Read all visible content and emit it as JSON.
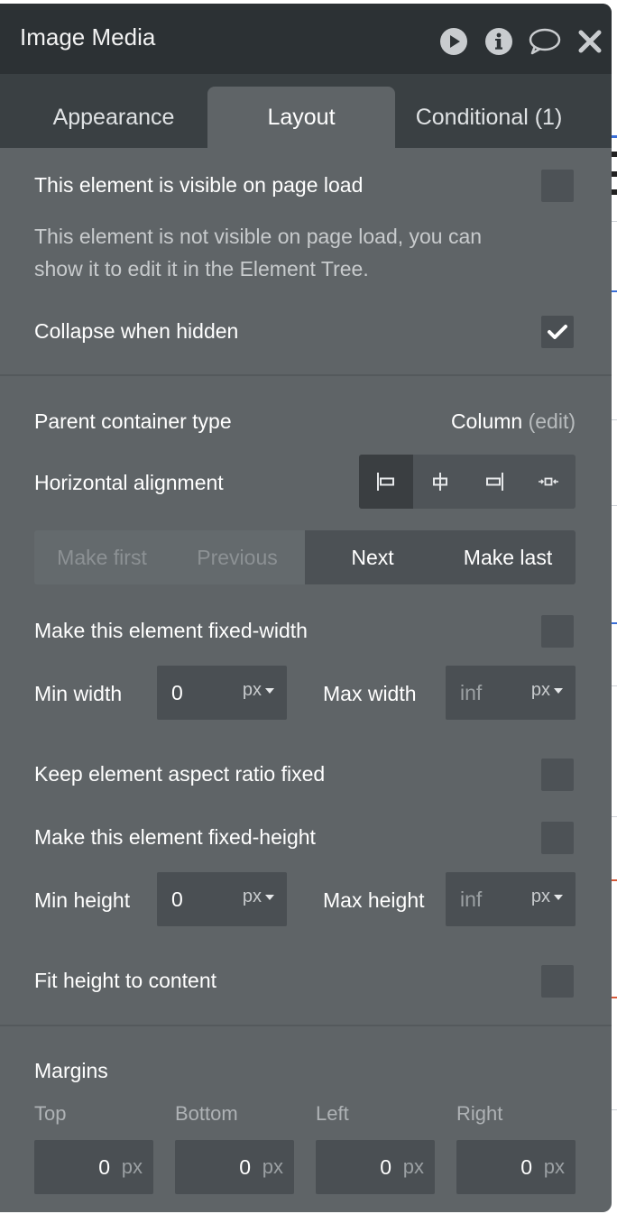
{
  "panel": {
    "title": "Image Media",
    "tabs": [
      {
        "label": "Appearance"
      },
      {
        "label": "Layout"
      },
      {
        "label": "Conditional (1)"
      }
    ]
  },
  "visibility": {
    "visible_label": "This element is visible on page load",
    "visible_checked": false,
    "hint_line1": "This element is not visible on page load, you can",
    "hint_line2": "show it to edit it in the Element Tree.",
    "collapse_label": "Collapse when hidden",
    "collapse_checked": true
  },
  "container": {
    "parent_type_label": "Parent container type",
    "parent_type_value": "Column",
    "edit_link": "(edit)",
    "halign_label": "Horizontal alignment",
    "halign_options": [
      "align-left-icon",
      "align-center-icon",
      "align-right-icon",
      "align-stretch-icon"
    ],
    "halign_selected": "align-left-icon"
  },
  "order": {
    "make_first": "Make first",
    "previous": "Previous",
    "next": "Next",
    "make_last": "Make last"
  },
  "width": {
    "fixed_label": "Make this element fixed-width",
    "fixed_checked": false,
    "min_label": "Min width",
    "min_value": "0",
    "min_unit": "px",
    "max_label": "Max width",
    "max_placeholder": "inf",
    "max_unit": "px"
  },
  "aspect": {
    "label": "Keep element aspect ratio fixed",
    "checked": false
  },
  "height": {
    "fixed_label": "Make this element fixed-height",
    "fixed_checked": false,
    "min_label": "Min height",
    "min_value": "0",
    "min_unit": "px",
    "max_label": "Max height",
    "max_placeholder": "inf",
    "max_unit": "px",
    "fit_label": "Fit height to content",
    "fit_checked": false
  },
  "margins": {
    "title": "Margins",
    "top_label": "Top",
    "bottom_label": "Bottom",
    "left_label": "Left",
    "right_label": "Right",
    "top_value": "0",
    "bottom_value": "0",
    "left_value": "0",
    "right_value": "0",
    "unit": "px"
  },
  "colors": {
    "panel_bg": "#5f6467",
    "titlebar_bg": "#2c3134",
    "tabbar_bg": "#3a4043",
    "input_bg": "#4a4f53"
  }
}
